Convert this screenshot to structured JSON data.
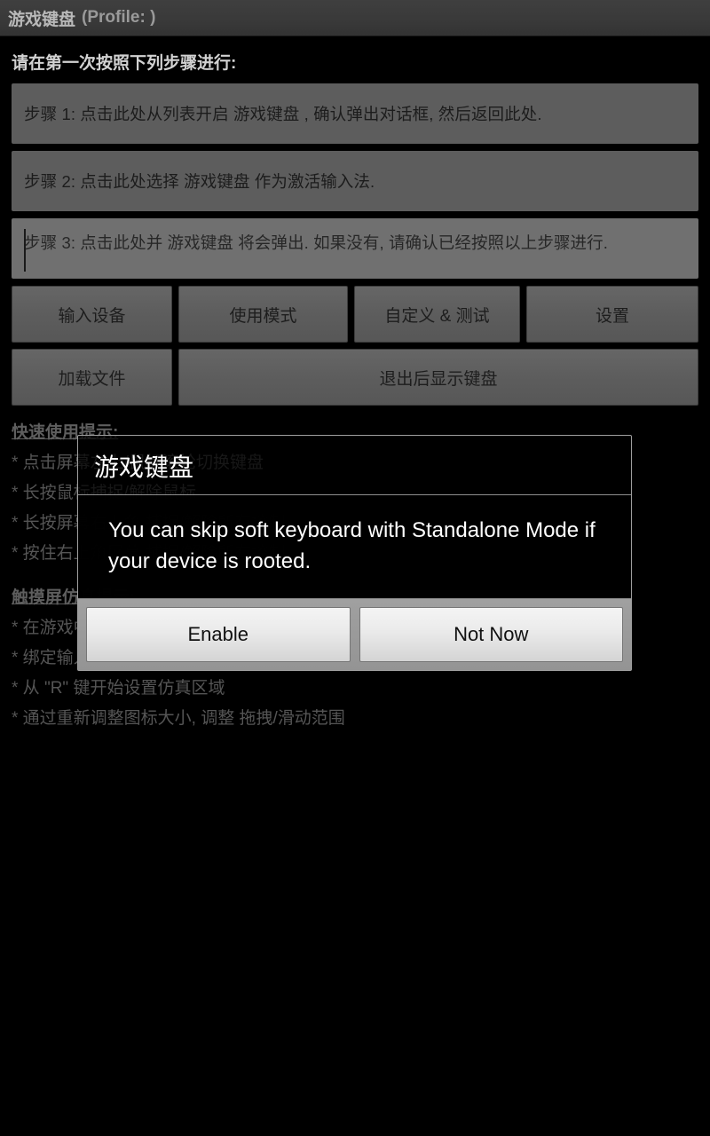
{
  "titlebar": {
    "app_name": "游戏键盘",
    "profile_label": "(Profile: )"
  },
  "main": {
    "intro": "请在第一次按照下列步骤进行:",
    "steps": [
      {
        "text": "步骤 1: 点击此处从列表开启 游戏键盘 , 确认弹出对话框, 然后返回此处."
      },
      {
        "text": "步骤 2: 点击此处选择 游戏键盘 作为激活输入法."
      },
      {
        "text": "步骤 3: 点击此处并 游戏键盘 将会弹出. 如果没有, 请确认已经按照以上步骤进行."
      }
    ],
    "buttons_row1": [
      {
        "label": "输入设备"
      },
      {
        "label": "使用模式"
      },
      {
        "label": "自定义 & 测试"
      },
      {
        "label": "设置"
      }
    ],
    "buttons_row2": [
      {
        "label": "加载文件"
      },
      {
        "label": "退出后显示键盘"
      }
    ],
    "hints": {
      "section1_title": "快速使用提示:",
      "section1_lines": [
        "* 点击屏幕左上/鼠标滚轮切换键盘",
        "* 长按鼠标捕捉/解除鼠标",
        "* 长按屏幕右上角 捕捉/解除所有控制",
        "* 按住右上角屏幕 捕捉/解除所有控制"
      ],
      "section2_title": "触摸屏仿真提示:",
      "section2_lines": [
        "* 在游戏中使用触摸屏仿真",
        "* 绑定输入键到屏幕位置",
        "* 从 \"R\" 键开始设置仿真区域",
        "* 通过重新调整图标大小, 调整 拖拽/滑动范围"
      ]
    }
  },
  "dialog": {
    "title": "游戏键盘",
    "message": "You can skip soft keyboard with Standalone Mode if your device is rooted.",
    "primary_button": "Enable",
    "secondary_button": "Not Now"
  },
  "colors": {
    "background": "#000000",
    "titlebar": "#3a3a3a",
    "step_box": "#5d5d5d",
    "step_box_active": "#707070",
    "button_face": "#5d5d5d",
    "dialog_button": "#eaeaea",
    "hint_text": "#555555"
  }
}
